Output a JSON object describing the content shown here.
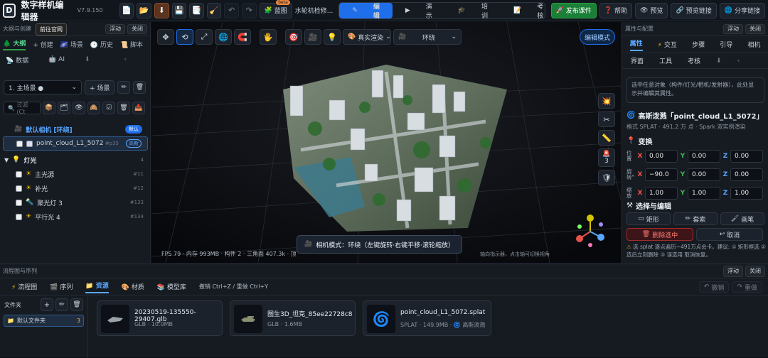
{
  "app": {
    "name": "数字样机编辑器",
    "version": "V7.9.150",
    "logo_letter": "D"
  },
  "toolbar": {
    "icons": [
      "new-file-icon",
      "open-folder-icon",
      "download-icon",
      "save-icon",
      "copy-icon",
      "broom-icon",
      "undo-icon",
      "redo-icon"
    ],
    "import_label": "蓝图",
    "import_badge": "beta",
    "doc_title": "水轮机检修...",
    "modes": [
      {
        "label": "编辑",
        "icon": "✎",
        "on": true
      },
      {
        "label": "演示",
        "icon": "▶",
        "on": false
      },
      {
        "label": "培训",
        "icon": "🎓",
        "on": false
      },
      {
        "label": "考核",
        "icon": "📝",
        "on": false
      }
    ],
    "publish": "发布课件",
    "help": "帮助",
    "preview": "预览",
    "preview_link": "预览链接",
    "share_link": "分享链接"
  },
  "left": {
    "title": "大纲与创建",
    "float": "浮动",
    "close": "关闭",
    "tooltip": "前往官网",
    "tabs": [
      "大纲",
      "+ 创建",
      "场景",
      "历史",
      "脚本"
    ],
    "subtabs": [
      "数据",
      "AI"
    ],
    "scene_select": "1. 主场景 ●",
    "add_scene": "+ 场景",
    "filter_placeholder": "过滤 (Ct",
    "camera_label": "默认相机 [环绕]",
    "camera_badge": "默认",
    "item_selected": "point_cloud_L1_5072",
    "item_selected_tag": "#p35",
    "item_selected_badge": "高斯",
    "light_group": "灯光",
    "light_count": "4",
    "lights": [
      {
        "name": "主光源",
        "tag": "#11",
        "icon": "☀"
      },
      {
        "name": "补光",
        "tag": "#12",
        "icon": "☀"
      },
      {
        "name": "聚光灯 3",
        "tag": "#133",
        "icon": "🔦"
      },
      {
        "name": "平行光 4",
        "tag": "#134",
        "icon": "☀"
      }
    ]
  },
  "viewport": {
    "render_select": "真实渲染",
    "orbit_select": "环绕",
    "mode_button": "编辑模式",
    "status": "FPS 79 · 内存 993MB · 构件 2 · 三角面 407.3k · 顶",
    "hint": "相机模式：环绕（左键旋转·右键平移·滚轮缩放）",
    "hint_right": "轴向指示器，点击轴可切换视角",
    "side_count": "3"
  },
  "right": {
    "title": "属性与配置",
    "float": "浮动",
    "close": "关闭",
    "tabs1": [
      "属性",
      "交互",
      "步骤",
      "引导",
      "相机"
    ],
    "tabs2": [
      "界面",
      "工具",
      "考核"
    ],
    "info": "选中任意对象（构件/灯光/相机/发射器），此处显示并编辑其属性。",
    "object_title": "高斯泼溅「point_cloud_L1_5072」",
    "object_meta": "格式 SPLAT · 491.2 万 点 · Spark 双实例渲染",
    "transform": "变换",
    "pos_label": "位置",
    "rot_label": "旋转°",
    "scale_label": "缩放",
    "pos": [
      "0.00",
      "0.00",
      "0.00"
    ],
    "rot": [
      "−90.0",
      "0.00",
      "0.00"
    ],
    "scale": [
      "1.00",
      "1.00",
      "1.00"
    ],
    "select_edit": "选择与编辑",
    "rect": "矩形",
    "lasso": "套索",
    "brush": "画笔",
    "delete_sel": "删除选中",
    "cancel": "取消",
    "warning": "选 splat 逐点遍历~491万点会卡。建议: ① 矩形框选 ② 选后立刻删除 ③ 误选用 取消恢复。"
  },
  "bottom": {
    "title": "流程图与序列",
    "float": "浮动",
    "close": "关闭",
    "tabs": [
      "流程图",
      "序列",
      "资源",
      "材质",
      "模型库"
    ],
    "shortcut": "撤销 Ctrl+Z / 重做 Ctrl+Y",
    "undo": "撤销",
    "redo": "重做",
    "folders_label": "文件夹",
    "default_folder": "默认文件夹",
    "default_folder_count": "3",
    "assets": [
      {
        "name": "20230519-135550-29407.glb",
        "meta": "GLB · 10.0MB"
      },
      {
        "name": "图生3D_坦克_85ee22728c8...",
        "meta": "GLB · 1.6MB"
      },
      {
        "name": "point_cloud_L1_5072.splat",
        "meta": "SPLAT · 149.9MB · 🌀 高斯泼溅"
      }
    ]
  },
  "colors": {
    "accent": "#1f6feb",
    "publish": "#1a7f37",
    "danger": "#a32a2a",
    "camera": "#58a6ff"
  }
}
